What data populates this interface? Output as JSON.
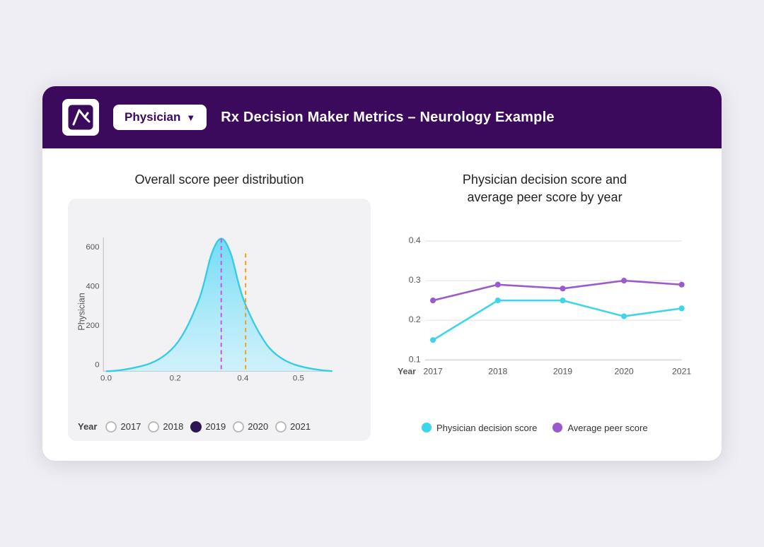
{
  "header": {
    "title": "Rx Decision Maker Metrics – Neurology Example",
    "dropdown_label": "Physician",
    "logo_alt": "logo"
  },
  "left_chart": {
    "title": "Overall score peer distribution",
    "y_axis_label": "Physician",
    "y_ticks": [
      "600",
      "400",
      "200",
      "0"
    ],
    "x_ticks": [
      "0.0",
      "0.2",
      "0.4",
      "0.5"
    ],
    "legend_year_label": "Year",
    "legend_years": [
      "2017",
      "2018",
      "2019",
      "2020",
      "2021"
    ],
    "selected_year": "2019"
  },
  "right_chart": {
    "title": "Physician decision score and\naverage peer score by year",
    "x_label": "Year",
    "x_ticks": [
      "2017",
      "2018",
      "2019",
      "2020",
      "2021"
    ],
    "y_ticks": [
      "0.4",
      "0.3",
      "0.2",
      "0.1"
    ],
    "physician_line": {
      "label": "Physician decision score",
      "color": "#3dd6e8",
      "points": [
        0.15,
        0.25,
        0.25,
        0.21,
        0.23
      ]
    },
    "peer_line": {
      "label": "Average peer score",
      "color": "#9b59d0",
      "points": [
        0.25,
        0.29,
        0.28,
        0.3,
        0.29
      ]
    }
  }
}
